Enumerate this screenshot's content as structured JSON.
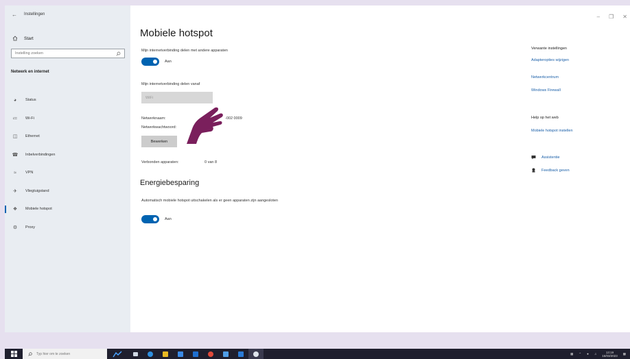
{
  "window": {
    "title": "Instellingen"
  },
  "sidebar": {
    "home_label": "Start",
    "search_placeholder": "Instelling zoeken",
    "section_title": "Netwerk en internet",
    "items": [
      {
        "label": "Status",
        "icon": "globe-icon",
        "active": false
      },
      {
        "label": "Wi-Fi",
        "icon": "wifi-icon",
        "active": false
      },
      {
        "label": "Ethernet",
        "icon": "ethernet-icon",
        "active": false
      },
      {
        "label": "Inbelverbindingen",
        "icon": "dialup-icon",
        "active": false
      },
      {
        "label": "VPN",
        "icon": "vpn-icon",
        "active": false
      },
      {
        "label": "Vliegtuigstand",
        "icon": "airplane-icon",
        "active": false
      },
      {
        "label": "Mobiele hotspot",
        "icon": "hotspot-icon",
        "active": true
      },
      {
        "label": "Proxy",
        "icon": "proxy-icon",
        "active": false
      }
    ]
  },
  "main": {
    "title": "Mobiele hotspot",
    "share_label": "Mijn internetverbinding delen met andere apparaten",
    "share_toggle": "Aan",
    "share_from_label": "Mijn internetverbinding delen vanaf",
    "share_from_value": "WiFi",
    "network_name_label": "Netwerknaam:",
    "network_name_value": "-002 0009",
    "network_password_label": "Netwerkwachtwoord:",
    "network_password_value": "",
    "edit_button": "Bewerken",
    "connected_label": "Verbonden apparaten:",
    "connected_value": "0 van 8",
    "energy_heading": "Energiebesparing",
    "energy_desc": "Automatisch mobiele hotspot uitschakelen als er geen apparaten zijn aangesloten",
    "energy_toggle": "Aan"
  },
  "right": {
    "related_heading": "Verwante instellingen",
    "related_links": [
      "Adapteropties wijzigen",
      "Netwerkcentrum",
      "Windows Firewall"
    ],
    "help_heading": "Help op het web",
    "help_link": "Mobiele hotspot instellen",
    "assist_label": "Assistentie",
    "feedback_label": "Feedback geven"
  },
  "taskbar": {
    "search_placeholder": "Typ hier om te zoeken",
    "time": "13:19",
    "date": "16/03/2023"
  },
  "colors": {
    "accent": "#0063b1",
    "link": "#1a5fa8",
    "sidebar_bg": "#e9edf2",
    "frame_bg": "#e6e0ef",
    "hand": "#7a1f5c"
  }
}
